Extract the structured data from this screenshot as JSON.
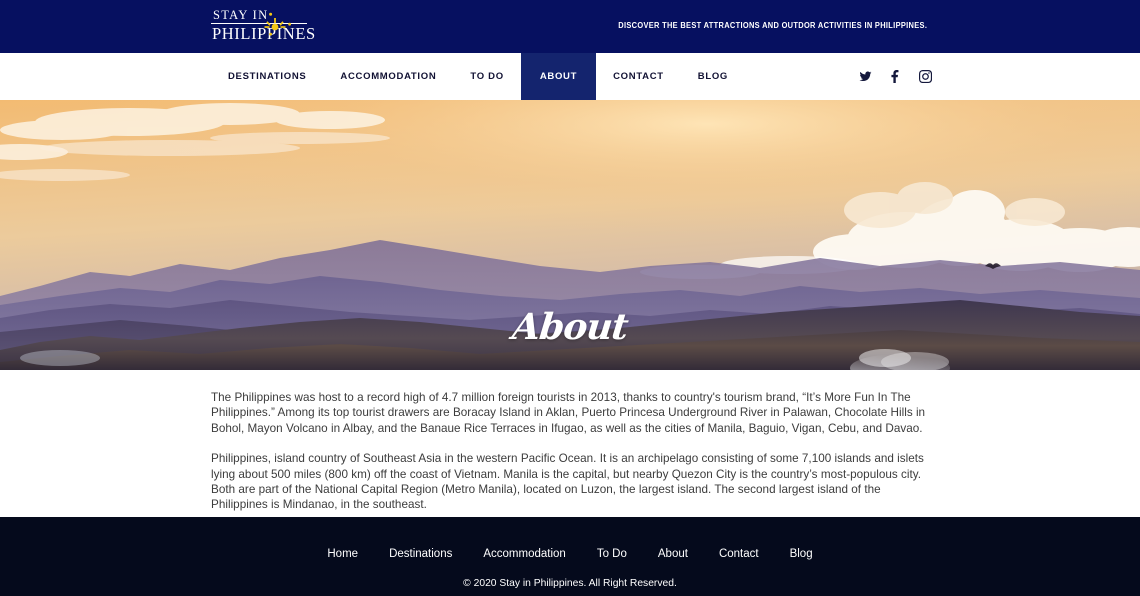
{
  "site": {
    "logo_line1": "STAY IN",
    "logo_line2": "PHILIPPINES",
    "tagline": "DISCOVER THE BEST ATTRACTIONS AND OUTDOR ACTIVITIES IN PHILIPPINES."
  },
  "nav": {
    "items": [
      {
        "label": "DESTINATIONS",
        "active": false
      },
      {
        "label": "ACCOMMODATION",
        "active": false
      },
      {
        "label": "TO DO",
        "active": false
      },
      {
        "label": "ABOUT",
        "active": true
      },
      {
        "label": "CONTACT",
        "active": false
      },
      {
        "label": "BLOG",
        "active": false
      }
    ],
    "social": [
      "twitter-icon",
      "facebook-icon",
      "instagram-icon"
    ]
  },
  "hero": {
    "title": "About"
  },
  "content": {
    "paragraph1": "The Philippines was host to a record high of 4.7 million foreign tourists in 2013, thanks to country's tourism brand, “It’s More Fun In The Philippines.” Among its top tourist drawers are Boracay Island in Aklan, Puerto Princesa Underground River in Palawan, Chocolate Hills in Bohol, Mayon Volcano in Albay, and the Banaue Rice Terraces in Ifugao, as well as the cities of Manila, Baguio, Vigan, Cebu, and Davao.",
    "paragraph2": "Philippines, island country of Southeast Asia in the western Pacific Ocean. It is an archipelago consisting of some 7,100 islands and islets lying about 500 miles (800 km) off the coast of Vietnam. Manila is the capital, but nearby Quezon City is the country’s most-populous city. Both are part of the National Capital Region (Metro Manila), located on Luzon, the largest island. The second largest island of the Philippines is Mindanao, in the southeast."
  },
  "footer": {
    "links": [
      "Home",
      "Destinations",
      "Accommodation",
      "To Do",
      "About",
      "Contact",
      "Blog"
    ],
    "copyright": "© 2020 Stay in Philippines. All Right Reserved."
  },
  "colors": {
    "header_bg": "#061060",
    "nav_active_bg": "#14246e",
    "footer_bg": "#050a1c",
    "logo_sun": "#f2c716",
    "body_text": "#3c3c3c"
  }
}
